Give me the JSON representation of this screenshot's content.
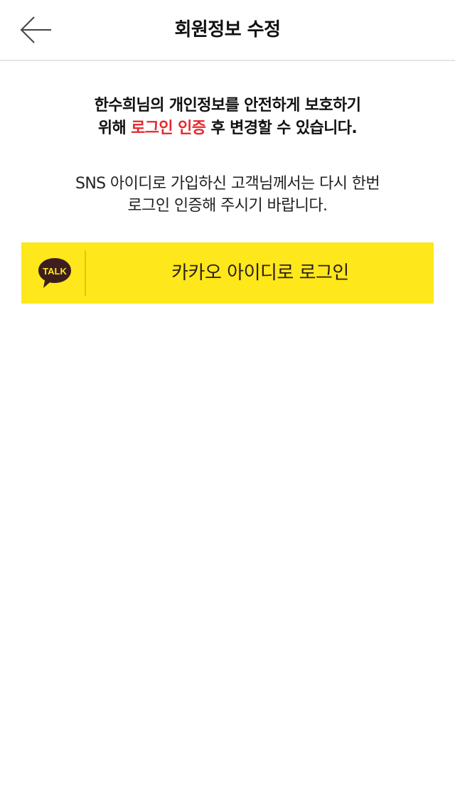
{
  "header": {
    "title": "회원정보 수정",
    "back_icon": "arrow-left-icon"
  },
  "intro": {
    "line1": "한수희님의 개인정보를 안전하게 보호하기",
    "line2_prefix": "위해 ",
    "line2_highlight": "로그인 인증",
    "line2_suffix": " 후 변경할 수 있습니다."
  },
  "sns_notice": {
    "line1": "SNS 아이디로 가입하신 고객님께서는 다시 한번",
    "line2": "로그인 인증해 주시기 바랍니다."
  },
  "kakao_button": {
    "label": "카카오 아이디로 로그인",
    "logo_text": "TALK",
    "logo_icon": "kakao-talk-icon"
  },
  "colors": {
    "highlight": "#e8262d",
    "kakao_yellow": "#fee71a",
    "kakao_brown": "#3c1e1e"
  }
}
